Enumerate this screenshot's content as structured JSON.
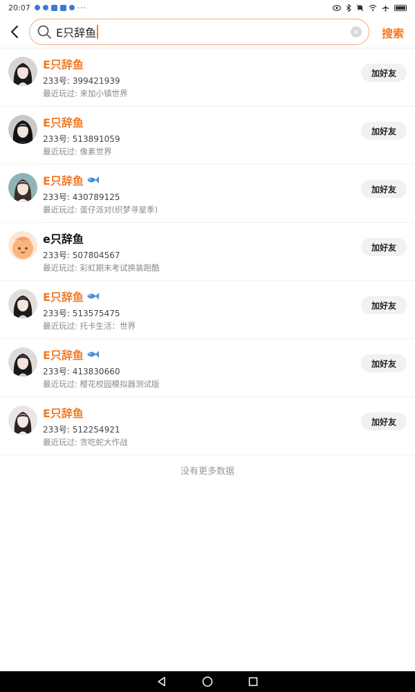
{
  "status_bar": {
    "time": "20:07",
    "more": "···"
  },
  "search": {
    "value": "E只辞鱼",
    "button_label": "搜索"
  },
  "results": [
    {
      "name": "E只辞鱼",
      "id_text": "233号: 399421939",
      "recent": "最近玩过: 来加小镇世界",
      "add_label": "加好友",
      "name_color": "orange",
      "fish": false
    },
    {
      "name": "E只辞鱼",
      "id_text": "233号: 513891059",
      "recent": "最近玩过: 像素世界",
      "add_label": "加好友",
      "name_color": "orange",
      "fish": false
    },
    {
      "name": "E只辞鱼",
      "id_text": "233号: 430789125",
      "recent": "最近玩过: 蛋仔派对(织梦寻星季)",
      "add_label": "加好友",
      "name_color": "orange",
      "fish": true
    },
    {
      "name": "e只辞鱼",
      "id_text": "233号: 507804567",
      "recent": "最近玩过: 彩虹期末考试换装跑酷",
      "add_label": "加好友",
      "name_color": "black",
      "fish": false
    },
    {
      "name": "E只辞鱼",
      "id_text": "233号: 513575475",
      "recent": "最近玩过: 托卡生活：世界",
      "add_label": "加好友",
      "name_color": "orange",
      "fish": true
    },
    {
      "name": "E只辞鱼",
      "id_text": "233号: 413830660",
      "recent": "最近玩过: 樱花校园模拟器测试版",
      "add_label": "加好友",
      "name_color": "orange",
      "fish": true
    },
    {
      "name": "E只辞鱼",
      "id_text": "233号: 512254921",
      "recent": "最近玩过: 贪吃蛇大作战",
      "add_label": "加好友",
      "name_color": "orange",
      "fish": false
    }
  ],
  "footer_text": "没有更多数据",
  "colors": {
    "accent": "#f07a28",
    "search_border": "#f5a97a",
    "add_button_bg": "#f1f1f4",
    "muted_text": "#8a8a8a"
  }
}
